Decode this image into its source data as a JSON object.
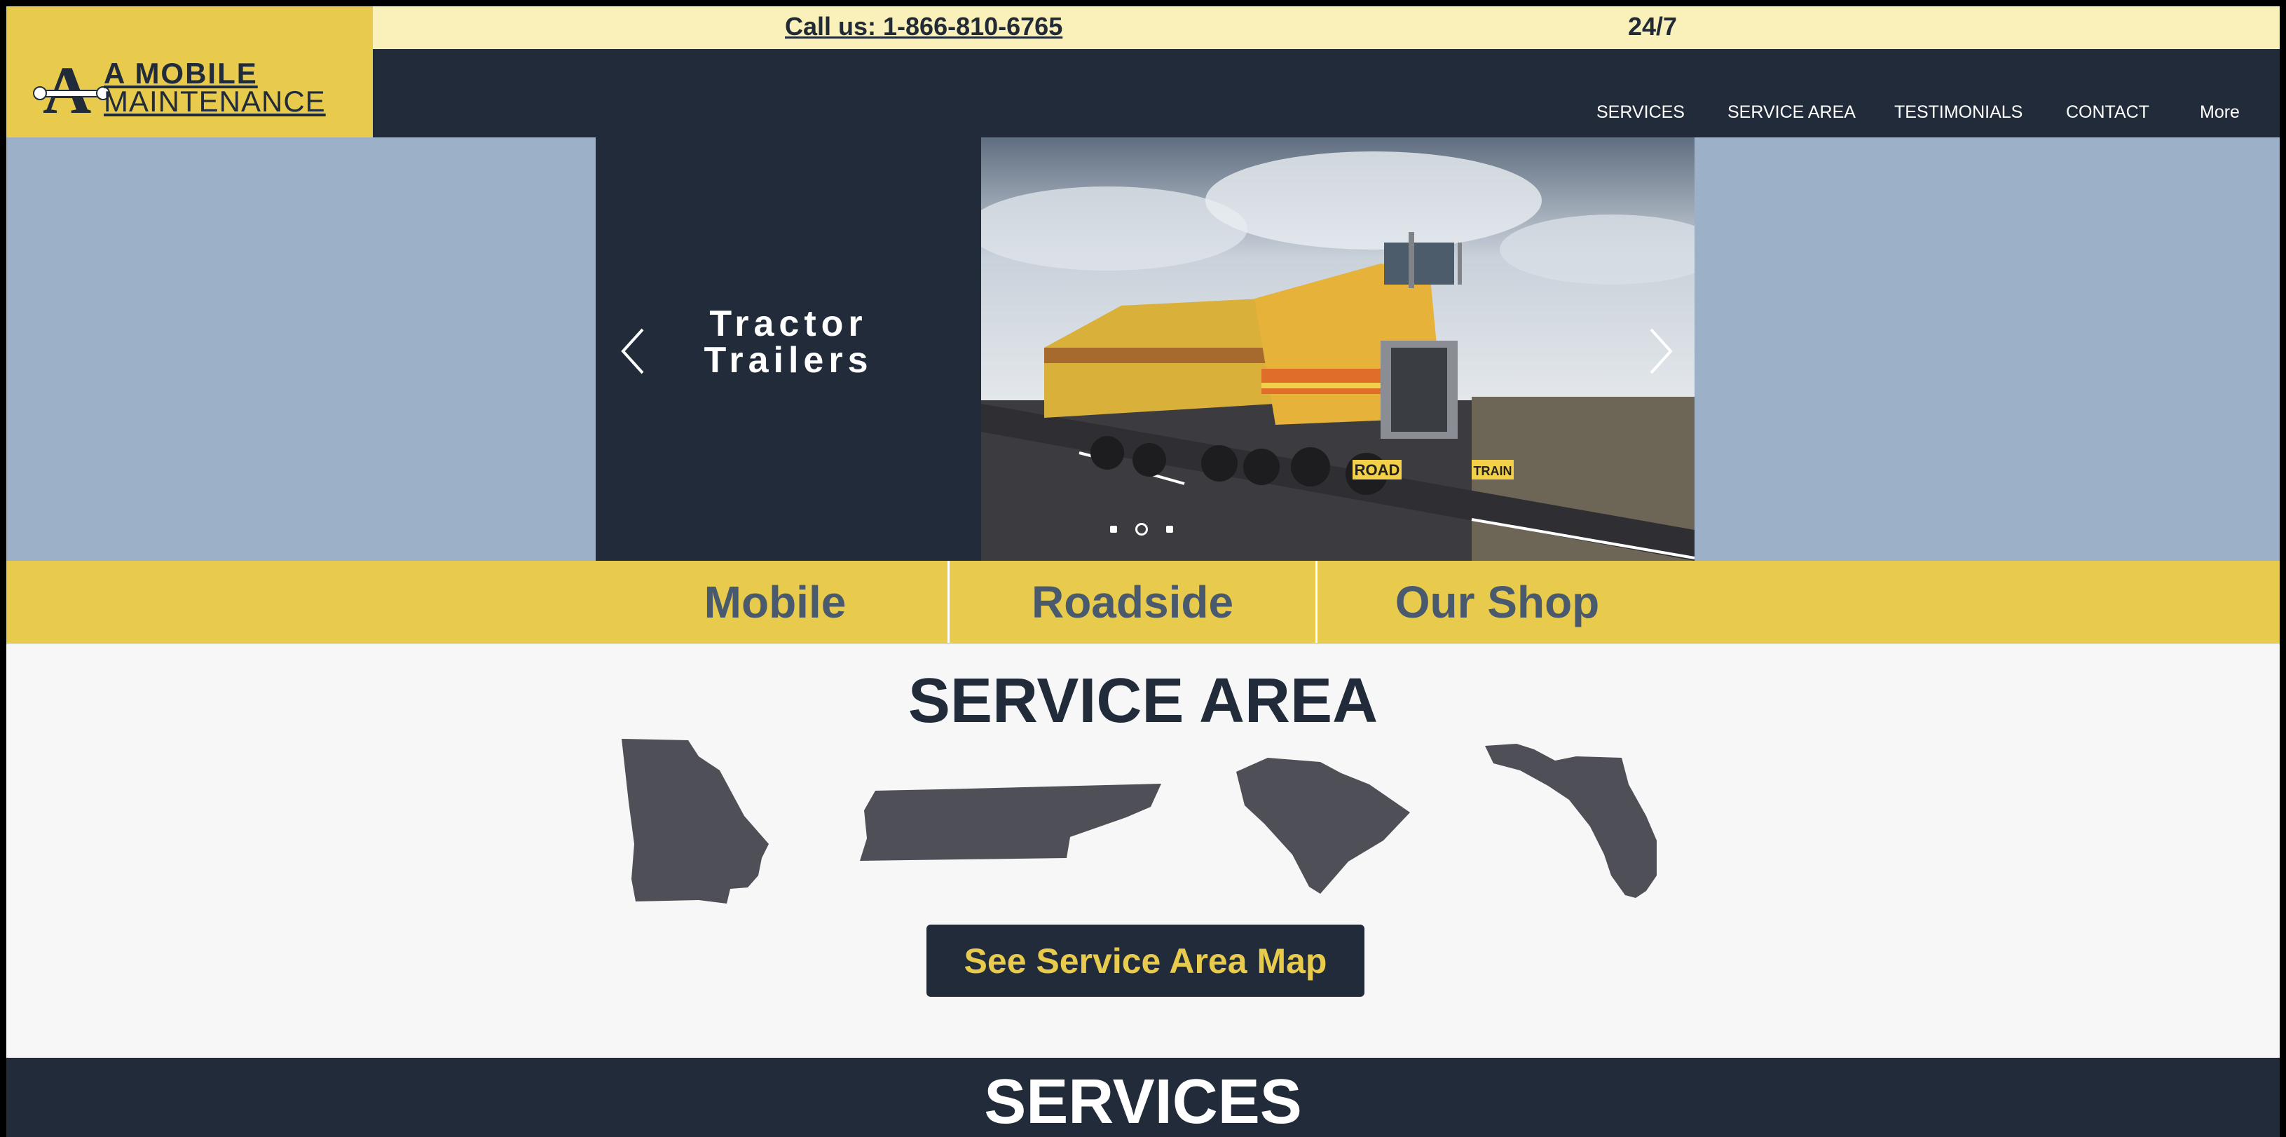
{
  "topbar": {
    "phone_label": "Call us: 1-866-810-6765",
    "hours": "24/7"
  },
  "brand": {
    "mark": "A",
    "line1": "A MOBILE",
    "line2": "MAINTENANCE"
  },
  "nav": {
    "items": [
      "SERVICES",
      "SERVICE AREA",
      "TESTIMONIALS",
      "CONTACT",
      "More"
    ]
  },
  "hero": {
    "slide_title_line1": "Tractor",
    "slide_title_line2": "Trailers",
    "photo_plate_left": "ROAD",
    "photo_plate_right": "TRAIN",
    "slide_count": 3,
    "active_slide": 2
  },
  "tabs": [
    "Mobile",
    "Roadside",
    "Our Shop"
  ],
  "service_area": {
    "title": "SERVICE AREA",
    "states": [
      "georgia-icon",
      "tennessee-icon",
      "south-carolina-icon",
      "florida-icon"
    ],
    "button_label": "See Service Area Map"
  },
  "services": {
    "title": "SERVICES"
  },
  "colors": {
    "navy": "#212b3a",
    "gold": "#e8cb4c",
    "cream": "#f9f1b9",
    "steel": "#9cb0c8",
    "state_gray": "#4f4f57"
  }
}
